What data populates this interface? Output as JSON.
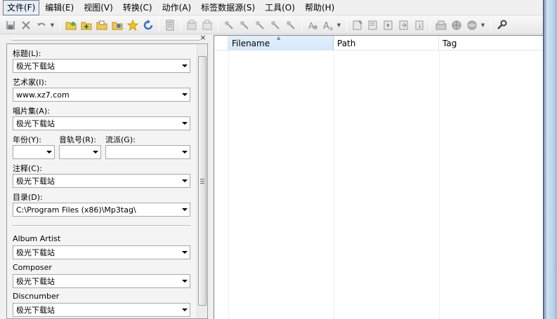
{
  "menu": [
    "文件(F)",
    "编辑(E)",
    "视图(V)",
    "转换(C)",
    "动作(A)",
    "标签数据源(S)",
    "工具(O)",
    "帮助(H)"
  ],
  "panel": {
    "close": "×",
    "fields": {
      "title": {
        "label": "标题(L):",
        "value": "极光下载站"
      },
      "artist": {
        "label": "艺术家(I):",
        "value": "www.xz7.com"
      },
      "album": {
        "label": "唱片集(A):",
        "value": "极光下载站"
      },
      "year": {
        "label": "年份(Y):",
        "value": ""
      },
      "track": {
        "label": "音轨号(R):",
        "value": ""
      },
      "genre": {
        "label": "流派(G):",
        "value": ""
      },
      "comment": {
        "label": "注释(C):",
        "value": "极光下载站"
      },
      "directory": {
        "label": "目录(D):",
        "value": "C:\\Program Files (x86)\\Mp3tag\\"
      },
      "album_artist": {
        "label": "Album Artist",
        "value": "极光下载站"
      },
      "composer": {
        "label": "Composer",
        "value": "极光下载站"
      },
      "discnumber": {
        "label": "Discnumber",
        "value": "极光下载站"
      }
    }
  },
  "list": {
    "columns": [
      "Filename",
      "Path",
      "Tag"
    ],
    "sort_indicator": "▲"
  },
  "colors": {
    "accent": "#d5e8f8",
    "window_frame": "#bcd4eb"
  }
}
